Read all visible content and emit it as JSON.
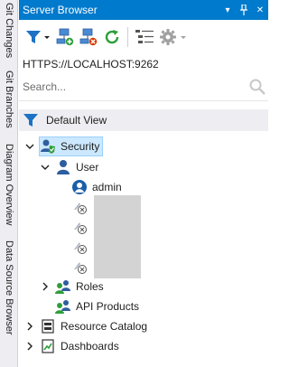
{
  "side_tabs": [
    {
      "label": "Git Changes"
    },
    {
      "label": "Git Branches"
    },
    {
      "label": "Diagram Overview"
    },
    {
      "label": "Data Source Browser"
    }
  ],
  "window": {
    "title": "Server Browser",
    "dropdown_glyph": "▾",
    "pin_glyph": "📌",
    "close_glyph": "✕"
  },
  "toolbar": {
    "items": [
      "filter-icon",
      "add-server-icon",
      "remove-server-icon",
      "refresh-icon",
      "tree-list-icon",
      "settings-gear-icon"
    ]
  },
  "connection": {
    "url": "HTTPS://LOCALHOST:9262"
  },
  "search": {
    "placeholder": "Search..."
  },
  "view": {
    "label": "Default View"
  },
  "tree": {
    "security": {
      "label": "Security",
      "expanded": true,
      "selected": true
    },
    "user": {
      "label": "User",
      "expanded": true
    },
    "admin": {
      "label": "admin"
    },
    "roles": {
      "label": "Roles",
      "expanded": false
    },
    "api_products": {
      "label": "API Products"
    },
    "resource_catalog": {
      "label": "Resource Catalog",
      "expanded": false
    },
    "dashboards": {
      "label": "Dashboards",
      "expanded": false
    }
  },
  "colors": {
    "accent": "#007acc",
    "selection": "#cce8ff",
    "refresh_green": "#2e9e3a",
    "remove_red": "#d83b01"
  }
}
